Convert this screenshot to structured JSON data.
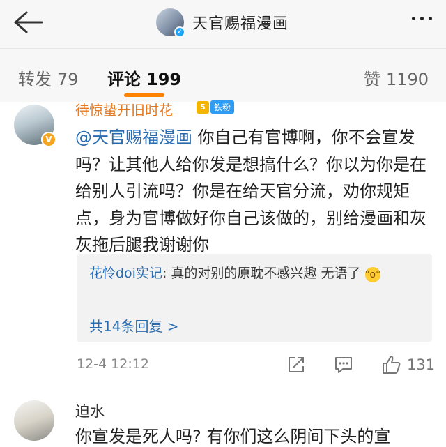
{
  "header": {
    "title": "天官赐福漫画"
  },
  "tabs": [
    {
      "label": "转发",
      "count": "79"
    },
    {
      "label": "评论",
      "count": "199"
    },
    {
      "label": "赞",
      "count": "1190"
    }
  ],
  "comment": {
    "username": "待惊蛰开旧时花",
    "fan_badge_level": "5",
    "fan_badge": "铁粉",
    "mention": "@天官赐福漫画",
    "text": "你自己有官博啊，你不会宣发吗？让其他人给你发是想搞什么？你以为你是在给别人引流吗？你是在给天官分流，劝你规矩点，身为官博做好你自己该做的，别给漫画和灰灰拖后腿我谢谢你",
    "reply": {
      "username": "花怜doi实记",
      "text": "真的对别的原耽不感兴趣 无语了"
    },
    "more_replies": "共14条回复 >",
    "time": "12-4 12:12",
    "likes": "131"
  },
  "next_comment": {
    "username": "迫水",
    "text": "你宣发是死人吗? 有你们这么阴间下头的宣"
  },
  "colors": {
    "accent": "#ff8200",
    "link": "#2a6cb0",
    "username_vip": "#e6791f"
  },
  "icons": [
    "back-arrow-icon",
    "more-dots-icon",
    "share-icon",
    "comment-icon",
    "like-icon",
    "verified-icon",
    "emoji-icon"
  ]
}
